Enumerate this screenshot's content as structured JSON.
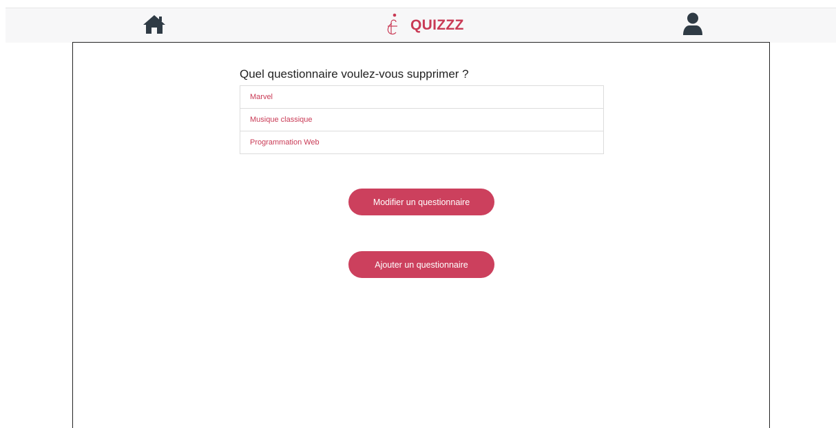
{
  "header": {
    "home_icon": "home-icon",
    "logo_icon": "logo-icon",
    "title": "QUIZZZ",
    "user_icon": "user-icon",
    "brand_color": "#c93a55",
    "icon_color": "#2f3b45"
  },
  "main": {
    "question": "Quel questionnaire voulez-vous supprimer ?",
    "quizzes": [
      {
        "label": "Marvel"
      },
      {
        "label": "Musique classique"
      },
      {
        "label": "Programmation Web"
      }
    ],
    "modify_button": "Modifier un questionnaire",
    "add_button": "Ajouter un questionnaire",
    "button_color": "#cc405d"
  }
}
